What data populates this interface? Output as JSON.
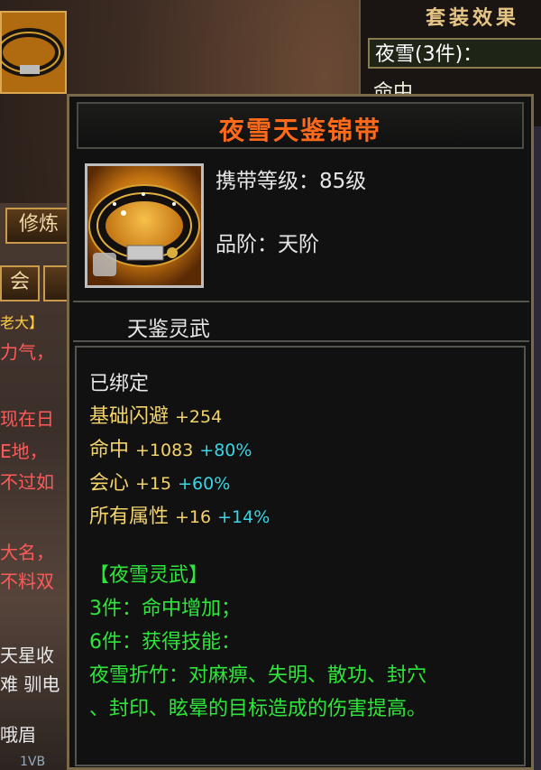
{
  "background": {
    "left_buttons": [
      "修炼",
      "会"
    ],
    "story_lines": [
      {
        "text": "老大】",
        "color": "gold"
      },
      {
        "text": "力气，",
        "color": "red"
      },
      {
        "text": "现在日",
        "color": "red"
      },
      {
        "text": "E地，",
        "color": "red"
      },
      {
        "text": "不过如",
        "color": "red"
      },
      {
        "text": "大名，",
        "color": "red"
      },
      {
        "text": "不料双",
        "color": "red"
      },
      {
        "text": "天星收",
        "color": "white"
      },
      {
        "text": "难 驯电",
        "color": "white"
      },
      {
        "text": "哦眉",
        "color": "white"
      },
      {
        "text": "1VB",
        "color": "white"
      }
    ]
  },
  "set_panel": {
    "title": "套装效果",
    "set_name": "夜雪(3件)：",
    "row1": "命中"
  },
  "tooltip": {
    "item_name": "夜雪天鉴锦带",
    "carry_level": "携带等级：85级",
    "grade": "品阶：天阶",
    "series": "天鉴灵武",
    "bound": "已绑定",
    "stats": [
      {
        "name": "基础闪避",
        "base": "+254",
        "bonus": ""
      },
      {
        "name": "命中",
        "base": "+1083",
        "bonus": "+80%"
      },
      {
        "name": "会心",
        "base": "+15",
        "bonus": "+60%"
      },
      {
        "name": "所有属性",
        "base": "+16",
        "bonus": "+14%"
      }
    ],
    "set_header": "【夜雪灵武】",
    "set_effects": [
      "3件：命中增加；",
      "6件：获得技能：",
      "夜雪折竹：对麻痹、失明、散功、封穴",
      "、封印、眩晕的目标造成的伤害提高。"
    ]
  },
  "colors": {
    "title_orange": "#ff6a1a",
    "stat_gold": "#f3d36a",
    "bonus_cyan": "#38d6e6",
    "set_green": "#2ee63a"
  },
  "icons": {
    "item": "belt-icon",
    "bag": "bag-icon"
  }
}
